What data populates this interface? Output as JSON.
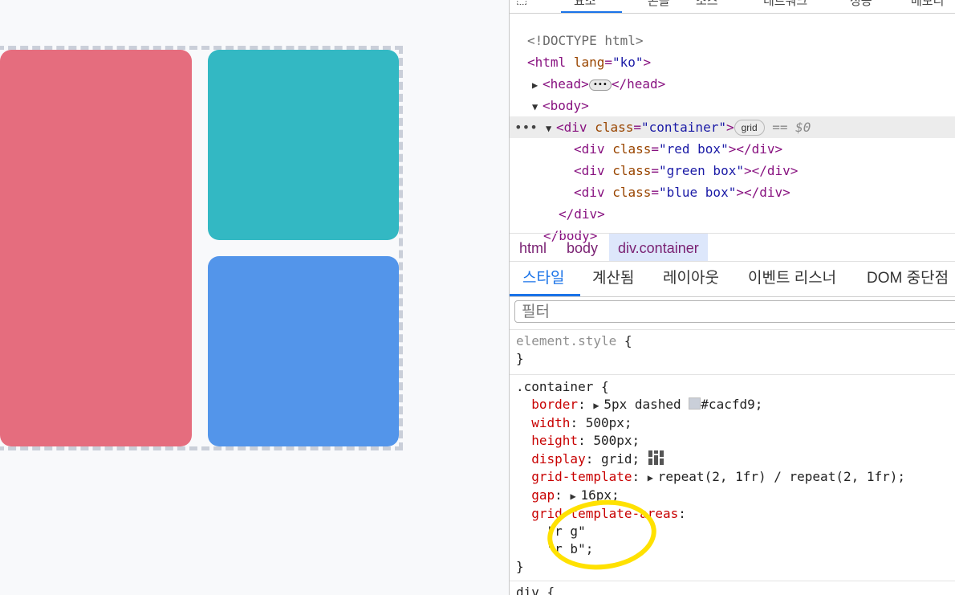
{
  "preview": {
    "colors": {
      "background": "#f8f9fb",
      "border": "#cacfd9",
      "red": "#e56d7e",
      "green": "#33b8c3",
      "blue": "#5395ea"
    }
  },
  "devtools": {
    "top_tabs": [
      "요소",
      "콘솔",
      "소스",
      "네트워크",
      "성능",
      "메모리"
    ],
    "dom": {
      "doctype": "<!DOCTYPE html>",
      "html_open_tag": "html",
      "html_attr_name": "lang",
      "html_attr_value": "\"ko\"",
      "head_tag": "head",
      "head_close": "</head>",
      "body_tag": "body",
      "div_tag": "div",
      "class_attr": "class",
      "container_class": "\"container\"",
      "grid_pill": "grid",
      "eq_label": "== $0",
      "children": [
        {
          "class_value": "\"red box\""
        },
        {
          "class_value": "\"green box\""
        },
        {
          "class_value": "\"blue box\""
        }
      ],
      "div_close": "</div>",
      "body_close": "</body>"
    },
    "breadcrumbs": [
      "html",
      "body",
      "div.container"
    ],
    "subtabs": [
      "스타일",
      "계산됨",
      "레이아웃",
      "이벤트 리스너",
      "DOM 중단점"
    ],
    "filter_placeholder": "필터",
    "styles": {
      "element_style_selector": "element.style",
      "open_brace": " {",
      "close_brace": "}",
      "container_selector": ".container",
      "border_prop": "border",
      "border_value": "5px dashed",
      "border_color": "#cacfd9;",
      "width_prop": "width",
      "width_value": "500px;",
      "height_prop": "height",
      "height_value": "500px;",
      "display_prop": "display",
      "display_value": "grid;",
      "grid_template_prop": "grid-template",
      "grid_template_value": "repeat(2, 1fr) / repeat(2, 1fr);",
      "gap_prop": "gap",
      "gap_value": "16px;",
      "areas_prop": "grid-template-areas",
      "areas_line1": "\"r g\"",
      "areas_line2": "\"r b\";",
      "next_selector": "div {"
    }
  }
}
